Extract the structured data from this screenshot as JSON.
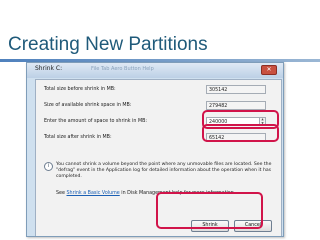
{
  "slide": {
    "title": "Creating New Partitions"
  },
  "window": {
    "title": "Shrink C:",
    "ghost_text": "File   Tab   Aero Button   Help",
    "close_glyph": "✕"
  },
  "dialog": {
    "fields": [
      {
        "label": "Total size before shrink in MB:",
        "value": "305142"
      },
      {
        "label": "Size of available shrink space in MB:",
        "value": "279482"
      },
      {
        "label": "Enter the amount of space to shrink in MB:",
        "value": "240000"
      },
      {
        "label": "Total size after shrink in MB:",
        "value": "65142"
      }
    ],
    "info_glyph": "i",
    "warning": "You cannot shrink a volume beyond the point where any unmovable files are located. See the \"defrag\" event in the Application log for detailed information about the operation when it has completed.",
    "help_prefix": "See ",
    "help_link": "Shrink a Basic Volume",
    "help_suffix": " in Disk Management help for more information.",
    "buttons": {
      "shrink": "Shrink",
      "cancel": "Cancel"
    }
  },
  "colors": {
    "title": "#1f5a7a",
    "highlight": "#d1144a",
    "link": "#1a5fb4"
  }
}
